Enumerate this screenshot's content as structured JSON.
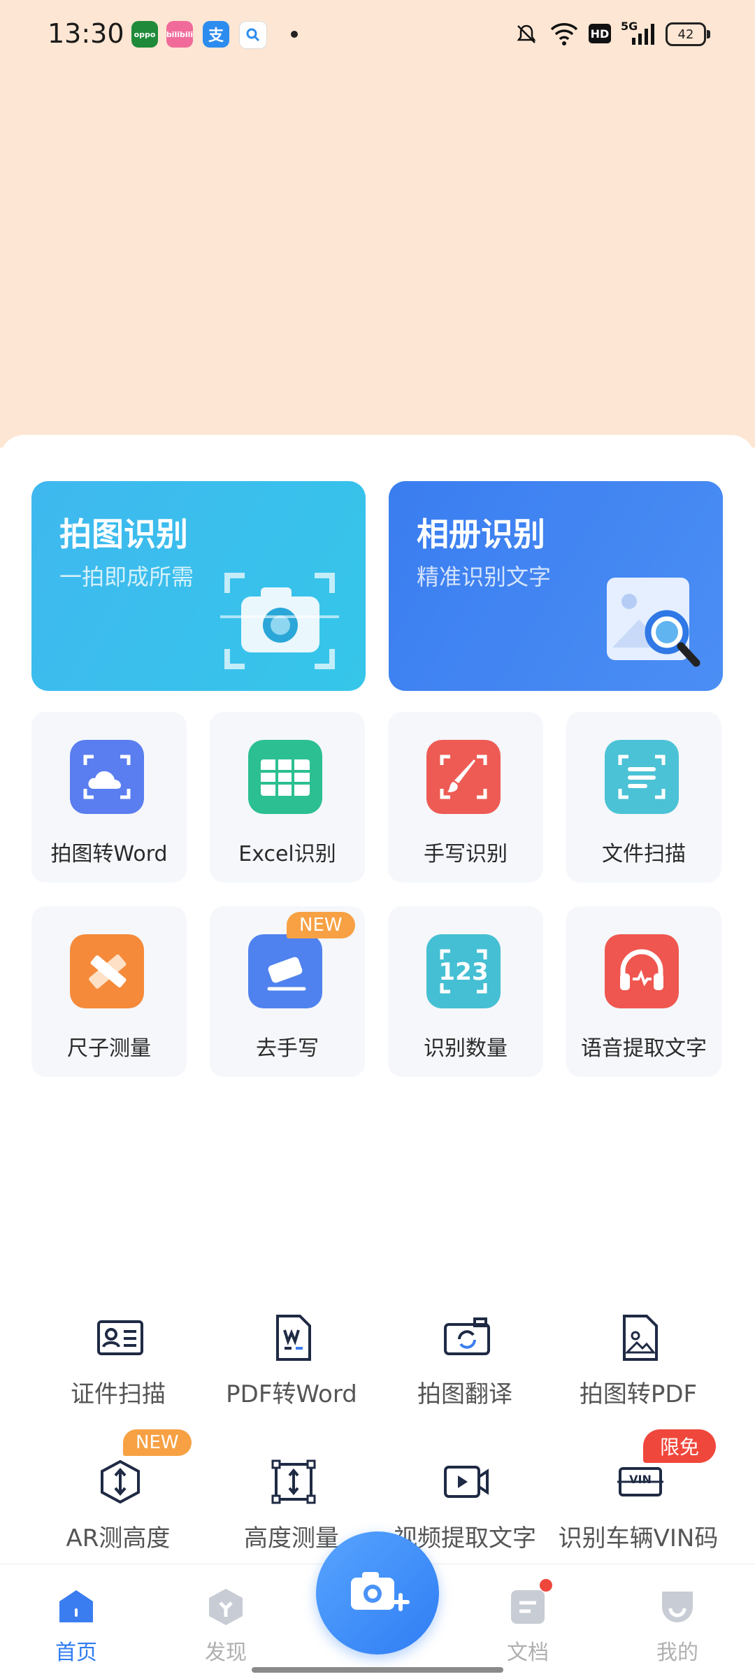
{
  "status_bar": {
    "time": "13:30",
    "apps": [
      "oppo",
      "bilibili",
      "支",
      "search"
    ],
    "hd": "HD",
    "network": "5G",
    "battery": "42"
  },
  "cards": [
    {
      "title": "拍图识别",
      "subtitle": "一拍即成所需"
    },
    {
      "title": "相册识别",
      "subtitle": "精准识别文字"
    }
  ],
  "grid": [
    {
      "label": "拍图转Word"
    },
    {
      "label": "Excel识别"
    },
    {
      "label": "手写识别"
    },
    {
      "label": "文件扫描"
    },
    {
      "label": "尺子测量"
    },
    {
      "label": "去手写",
      "badge": "NEW"
    },
    {
      "label": "识别数量",
      "icon_text": "123"
    },
    {
      "label": "语音提取文字"
    }
  ],
  "tools": [
    {
      "label": "证件扫描"
    },
    {
      "label": "PDF转Word"
    },
    {
      "label": "拍图翻译"
    },
    {
      "label": "拍图转PDF"
    },
    {
      "label": "AR测高度",
      "badge": "NEW"
    },
    {
      "label": "高度测量"
    },
    {
      "label": "视频提取文字"
    },
    {
      "label": "识别车辆VIN码",
      "badge": "限免",
      "icon_text": "VIN"
    }
  ],
  "nav": [
    {
      "label": "首页",
      "active": true
    },
    {
      "label": "发现"
    },
    {
      "label": "文档",
      "has_dot": true
    },
    {
      "label": "我的"
    }
  ],
  "colors": {
    "accent": "#2f7cf0",
    "badge_orange": "#f7a144",
    "badge_red": "#f0473c",
    "hero_bg": "#fde6d3"
  }
}
